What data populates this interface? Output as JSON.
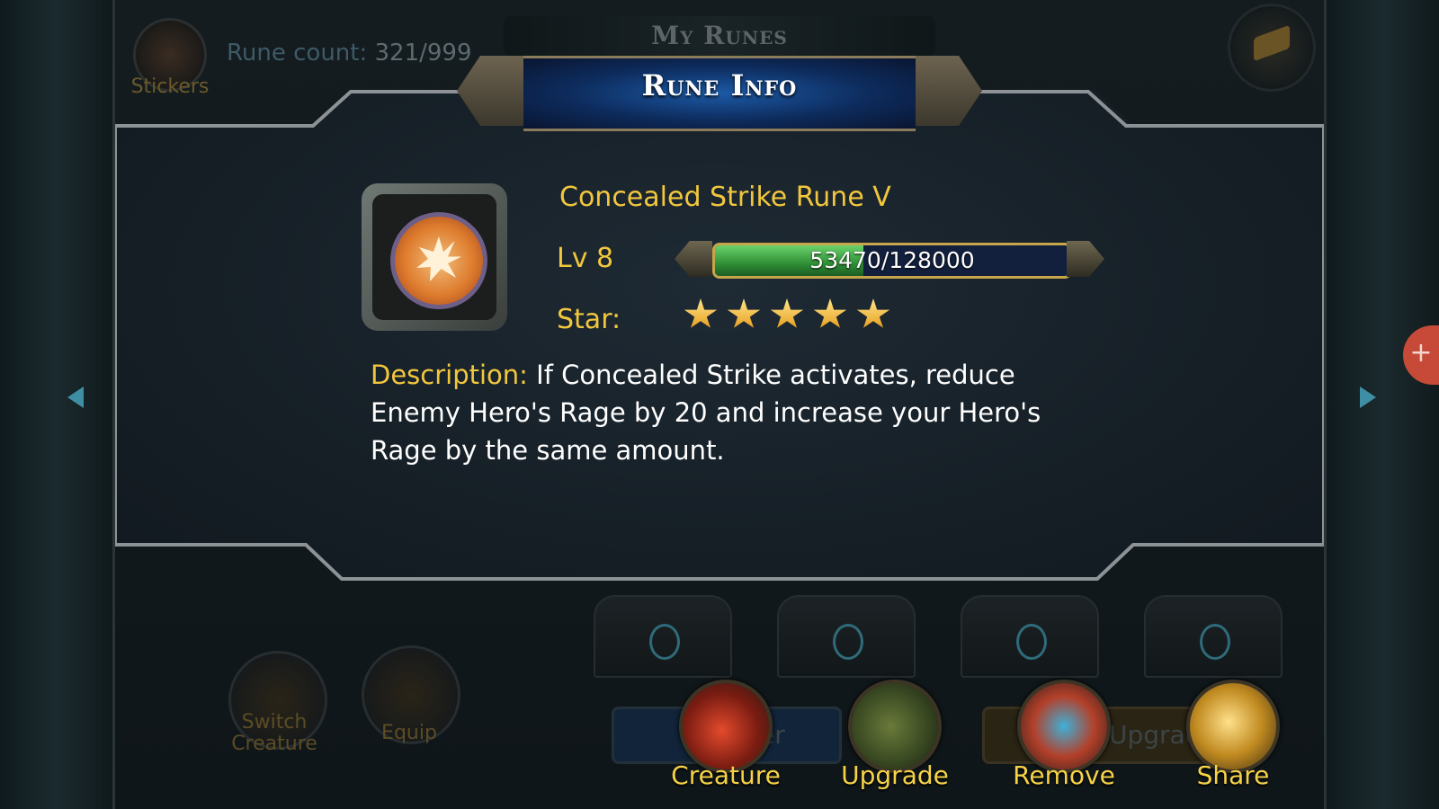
{
  "background": {
    "title": "My Runes",
    "stickers_label": "Stickers",
    "rune_count_label": "Rune count:",
    "rune_count_value": "321/999",
    "bottom_left": {
      "switch_creature_label": "Switch Creature",
      "equip_label": "Equip"
    },
    "hidden_bar_1": "ter",
    "hidden_bar_2": "Upgrad"
  },
  "dialog": {
    "title": "Rune Info",
    "rune": {
      "name": "Concealed Strike Rune V",
      "icon": "rune-burst-icon",
      "level_label": "Lv 8",
      "xp_current": 53470,
      "xp_max": 128000,
      "xp_text": "53470/128000",
      "star_label": "Star:",
      "stars": 5,
      "description_label": "Description:",
      "description_text": "If Concealed Strike activates, reduce Enemy Hero's Rage by 20 and increase your Hero's Rage by the same amount."
    }
  },
  "actions": [
    {
      "label": "Creature",
      "icon": "creature-hammer-icon"
    },
    {
      "label": "Upgrade",
      "icon": "upgrade-book-icon"
    },
    {
      "label": "Remove",
      "icon": "remove-tool-icon"
    },
    {
      "label": "Share",
      "icon": "share-horn-icon"
    }
  ],
  "colors": {
    "gold_text": "#f2c73d",
    "action_label": "#f6d247",
    "xp_fill": "#2f8f36",
    "title_blue": "#1c5aa6"
  }
}
